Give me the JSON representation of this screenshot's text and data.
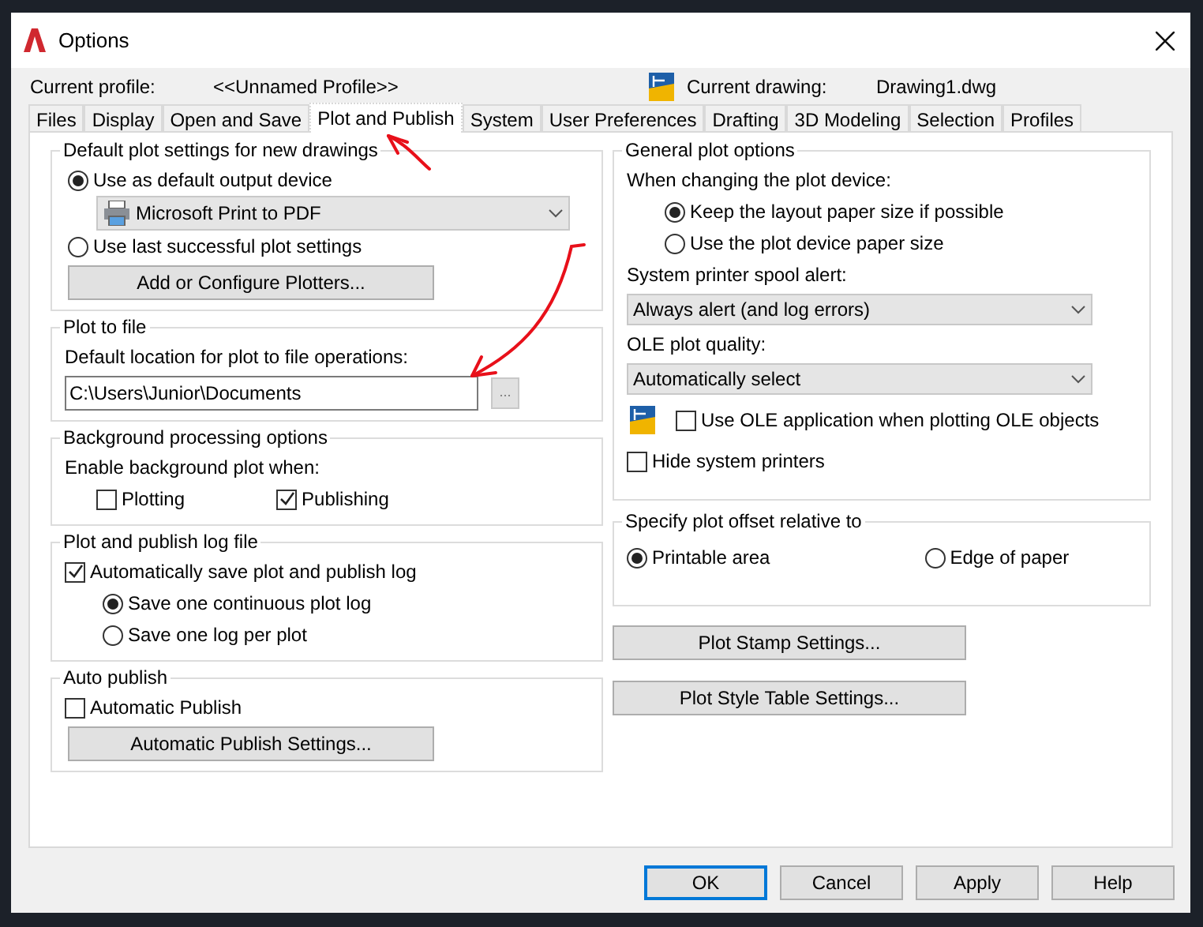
{
  "window": {
    "title": "Options"
  },
  "profile": {
    "label": "Current profile:",
    "value": "<<Unnamed Profile>>",
    "drawing_label": "Current drawing:",
    "drawing_value": "Drawing1.dwg"
  },
  "tabs": [
    {
      "label": "Files",
      "selected": false
    },
    {
      "label": "Display",
      "selected": false
    },
    {
      "label": "Open and Save",
      "selected": false
    },
    {
      "label": "Plot and Publish",
      "selected": true
    },
    {
      "label": "System",
      "selected": false
    },
    {
      "label": "User Preferences",
      "selected": false
    },
    {
      "label": "Drafting",
      "selected": false
    },
    {
      "label": "3D Modeling",
      "selected": false
    },
    {
      "label": "Selection",
      "selected": false
    },
    {
      "label": "Profiles",
      "selected": false
    }
  ],
  "left_groups": [
    {
      "title": "Default plot settings for new drawings",
      "items": [
        {
          "kind": "radio",
          "label": "Use as default output device",
          "selected": true
        },
        {
          "kind": "icon_dropdown",
          "value": "Microsoft Print to PDF"
        },
        {
          "kind": "radio",
          "label": "Use last successful plot settings",
          "selected": false
        },
        {
          "kind": "button",
          "label": "Add or Configure Plotters..."
        }
      ]
    },
    {
      "title": "Plot to file",
      "items": [
        {
          "kind": "label",
          "label": "Default location for plot to file operations:"
        },
        {
          "kind": "path_field",
          "value": "C:\\Users\\Junior\\Documents",
          "browse": "..."
        }
      ]
    },
    {
      "title": "Background processing options",
      "items": [
        {
          "kind": "label",
          "label": "Enable background plot when:"
        },
        {
          "kind": "checkbox_row",
          "options": [
            {
              "label": "Plotting",
              "checked": false
            },
            {
              "label": "Publishing",
              "checked": true
            }
          ]
        }
      ]
    },
    {
      "title": "Plot and publish log file",
      "items": [
        {
          "kind": "checkbox",
          "label": "Automatically save plot and publish log",
          "checked": true
        },
        {
          "kind": "sub_radio",
          "label": "Save one continuous plot log",
          "selected": true
        },
        {
          "kind": "sub_radio",
          "label": "Save one log per plot",
          "selected": false
        }
      ]
    },
    {
      "title": "Auto publish",
      "items": [
        {
          "kind": "checkbox",
          "label": "Automatic Publish",
          "checked": false
        },
        {
          "kind": "button",
          "label": "Automatic Publish Settings..."
        }
      ]
    }
  ],
  "right_groups": [
    {
      "title": "General plot options",
      "items": [
        {
          "kind": "label",
          "label": "When changing the plot device:"
        },
        {
          "kind": "sub_radio",
          "label": "Keep the layout paper size if possible",
          "selected": true
        },
        {
          "kind": "sub_radio",
          "label": "Use the plot device paper size",
          "selected": false
        },
        {
          "kind": "label",
          "label": "System printer spool alert:"
        },
        {
          "kind": "dropdown",
          "value": "Always alert (and log errors)"
        },
        {
          "kind": "label",
          "label": "OLE plot quality:"
        },
        {
          "kind": "dropdown",
          "value": "Automatically select"
        },
        {
          "kind": "icon_checkbox",
          "label": "Use OLE application when plotting OLE objects",
          "checked": false
        },
        {
          "kind": "checkbox",
          "label": "Hide system printers",
          "checked": false
        }
      ]
    },
    {
      "title": "Specify plot offset relative to",
      "items": [
        {
          "kind": "radio_row",
          "options": [
            {
              "label": "Printable area",
              "selected": true
            },
            {
              "label": "Edge of paper",
              "selected": false
            }
          ]
        }
      ]
    }
  ],
  "right_buttons": [
    "Plot Stamp Settings...",
    "Plot Style Table Settings..."
  ],
  "footer_buttons": [
    {
      "label": "OK",
      "default": true
    },
    {
      "label": "Cancel",
      "default": false
    },
    {
      "label": "Apply",
      "default": false
    },
    {
      "label": "Help",
      "default": false
    }
  ]
}
